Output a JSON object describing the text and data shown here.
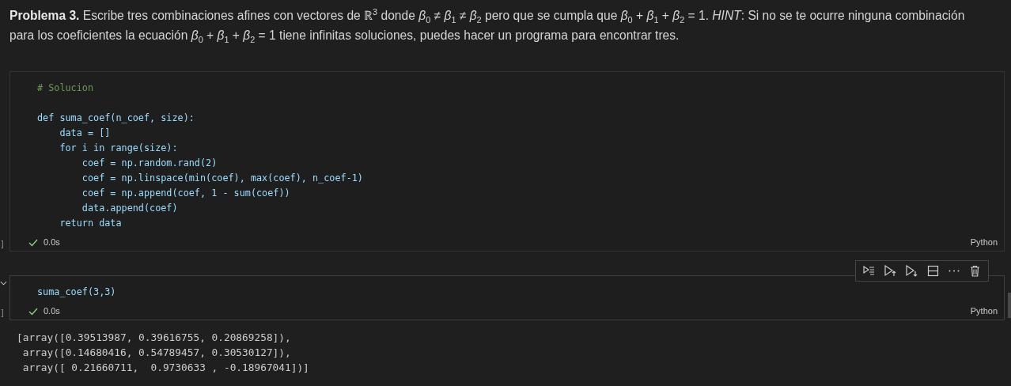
{
  "markdown": {
    "text": "**Problema 3.** Escribe tres combinaciones afines con vectores de ℝ$^{3}$ donde *β*$_{0}$ ≠ *β*$_{1}$ ≠ *β*$_{2}$ pero que se cumpla que *β*$_{0}$ + *β*$_{1}$ + *β*$_{2}$ = 1. *HINT*: Si no se te ocurre ninguna combinación para los coeficientes la ecuación *β*$_{0}$ + *β*$_{1}$ + *β*$_{2}$ = 1 tiene infinitas soluciones, puedes hacer un programa para encontrar tres."
  },
  "cells": [
    {
      "focused": false,
      "exec_count": "]",
      "time": "0.0s",
      "language": "Python",
      "lines": [
        {
          "text": "# Solucion",
          "kind": "comment"
        },
        {
          "text": "def suma_coef(n_coef, size):",
          "kind": "code",
          "blank_before": true
        },
        {
          "text": "    data = []",
          "kind": "code"
        },
        {
          "text": "    for i in range(size):",
          "kind": "code"
        },
        {
          "text": "        coef = np.random.rand(2)",
          "kind": "code"
        },
        {
          "text": "        coef = np.linspace(min(coef), max(coef), n_coef-1)",
          "kind": "code"
        },
        {
          "text": "        coef = np.append(coef, 1 - sum(coef))",
          "kind": "code"
        },
        {
          "text": "        data.append(coef)",
          "kind": "code"
        },
        {
          "text": "    return data",
          "kind": "code"
        }
      ]
    },
    {
      "focused": true,
      "exec_count": "]",
      "time": "0.0s",
      "language": "Python",
      "lines": [
        {
          "text": "suma_coef(3,3)",
          "kind": "code"
        }
      ],
      "output": [
        "[array([0.39513987, 0.39616755, 0.20869258]),",
        " array([0.14680416, 0.54789457, 0.30530127]),",
        " array([ 0.21660711,  0.9730633 , -0.18967041])]"
      ]
    }
  ]
}
